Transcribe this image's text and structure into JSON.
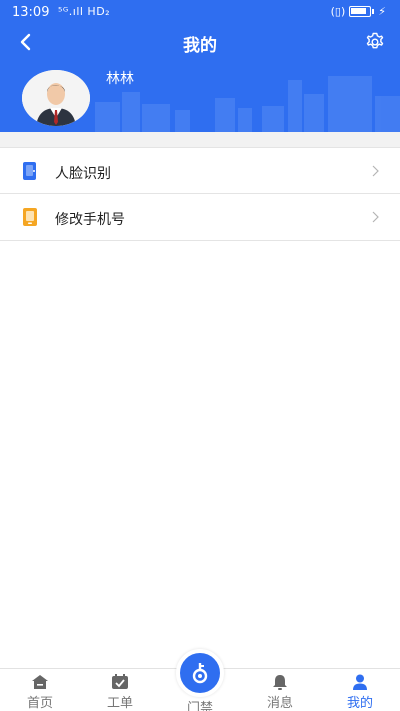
{
  "status_bar": {
    "time": "13:09",
    "network": "⁵ᴳ.ıll HD₂",
    "right_text": "(▯)"
  },
  "header": {
    "title": "我的",
    "back_icon": "chevron-left-icon",
    "settings_icon": "gear-icon"
  },
  "profile": {
    "username": "林林",
    "avatar_icon": "avatar-man-suit"
  },
  "menu": {
    "items": [
      {
        "label": "人脸识别",
        "icon": "face-recognition-icon",
        "icon_color": "#2f6ef0"
      },
      {
        "label": "修改手机号",
        "icon": "phone-icon",
        "icon_color": "#f5a623"
      }
    ]
  },
  "tabbar": {
    "tabs": [
      {
        "label": "首页",
        "icon": "home-icon"
      },
      {
        "label": "工单",
        "icon": "work-order-icon"
      },
      {
        "label": "门禁",
        "icon": "key-icon"
      },
      {
        "label": "消息",
        "icon": "bell-icon"
      },
      {
        "label": "我的",
        "icon": "user-icon"
      }
    ],
    "active_index": 4
  },
  "colors": {
    "primary": "#2f6ef0",
    "accent_orange": "#f5a623"
  }
}
